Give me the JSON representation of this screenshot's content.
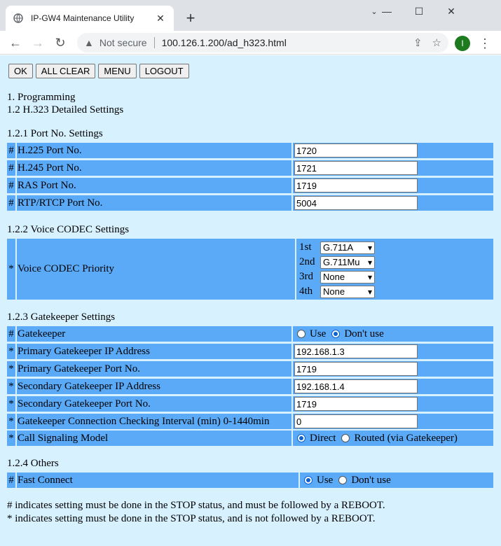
{
  "browser": {
    "tab_title": "IP-GW4 Maintenance Utility",
    "not_secure": "Not secure",
    "url": "100.126.1.200/ad_h323.html",
    "avatar_letter": "I"
  },
  "actions": {
    "ok": "OK",
    "all_clear": "ALL CLEAR",
    "menu": "MENU",
    "logout": "LOGOUT"
  },
  "headings": {
    "h1": "1. Programming",
    "h2": "1.2 H.323 Detailed Settings",
    "port": "1.2.1 Port No. Settings",
    "codec": "1.2.2 Voice CODEC Settings",
    "gatekeeper": "1.2.3 Gatekeeper Settings",
    "others": "1.2.4 Others"
  },
  "port_settings": [
    {
      "mark": "#",
      "label": "H.225 Port No.",
      "value": "1720"
    },
    {
      "mark": "#",
      "label": "H.245 Port No.",
      "value": "1721"
    },
    {
      "mark": "#",
      "label": "RAS Port No.",
      "value": "1719"
    },
    {
      "mark": "#",
      "label": "RTP/RTCP Port No.",
      "value": "5004"
    }
  ],
  "codec": {
    "mark": "*",
    "label": "Voice CODEC Priority",
    "priorities": [
      {
        "order": "1st",
        "value": "G.711A"
      },
      {
        "order": "2nd",
        "value": "G.711Mu"
      },
      {
        "order": "3rd",
        "value": "None"
      },
      {
        "order": "4th",
        "value": "None"
      }
    ]
  },
  "gatekeeper": {
    "enable": {
      "mark": "#",
      "label": "Gatekeeper",
      "opt1": "Use",
      "opt2": "Don't use",
      "selected": "Don't use"
    },
    "fields": [
      {
        "mark": "*",
        "label": "Primary Gatekeeper IP Address",
        "value": "192.168.1.3"
      },
      {
        "mark": "*",
        "label": "Primary Gatekeeper Port No.",
        "value": "1719"
      },
      {
        "mark": "*",
        "label": "Secondary Gatekeeper IP Address",
        "value": "192.168.1.4"
      },
      {
        "mark": "*",
        "label": "Secondary Gatekeeper Port No.",
        "value": "1719"
      },
      {
        "mark": "*",
        "label": "Gatekeeper Connection Checking Interval (min) 0-1440min",
        "value": "0"
      }
    ],
    "signaling": {
      "mark": "*",
      "label": "Call Signaling Model",
      "opt1": "Direct",
      "opt2": "Routed (via Gatekeeper)",
      "selected": "Direct"
    }
  },
  "others": {
    "fast_connect": {
      "mark": "#",
      "label": "Fast Connect",
      "opt1": "Use",
      "opt2": "Don't use",
      "selected": "Use"
    }
  },
  "notes": {
    "hash": "# indicates setting must be done in the STOP status, and must be followed by a REBOOT.",
    "star": "* indicates setting must be done in the STOP status, and is not followed by a REBOOT."
  },
  "colors": {
    "page_bg": "#d7f1ff",
    "row_bg": "#5aaaf8",
    "radio_on": "#0a62d0"
  }
}
